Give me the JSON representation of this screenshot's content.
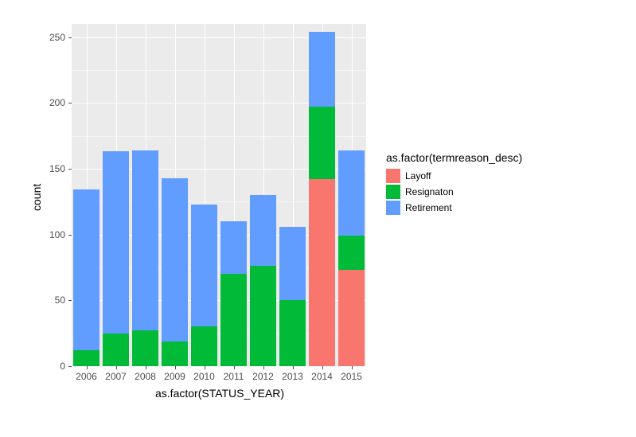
{
  "chart_data": {
    "type": "bar",
    "stacked": true,
    "categories": [
      "2006",
      "2007",
      "2008",
      "2009",
      "2010",
      "2011",
      "2012",
      "2013",
      "2014",
      "2015"
    ],
    "series": [
      {
        "name": "Layoff",
        "color": "#f8766d",
        "values": [
          0,
          0,
          0,
          0,
          0,
          0,
          0,
          0,
          142,
          73
        ]
      },
      {
        "name": "Resignaton",
        "color": "#00ba38",
        "values": [
          12,
          25,
          27,
          19,
          30,
          70,
          76,
          50,
          55,
          26
        ]
      },
      {
        "name": "Retirement",
        "color": "#619cff",
        "values": [
          122,
          138,
          137,
          124,
          93,
          40,
          54,
          56,
          57,
          65
        ]
      }
    ],
    "title": "",
    "xlabel": "as.factor(STATUS_YEAR)",
    "ylabel": "count",
    "ylim": [
      0,
      260
    ],
    "y_ticks": [
      0,
      50,
      100,
      150,
      200,
      250
    ],
    "legend_title": "as.factor(termreason_desc)",
    "legend_items": [
      "Layoff",
      "Resignaton",
      "Retirement"
    ]
  }
}
